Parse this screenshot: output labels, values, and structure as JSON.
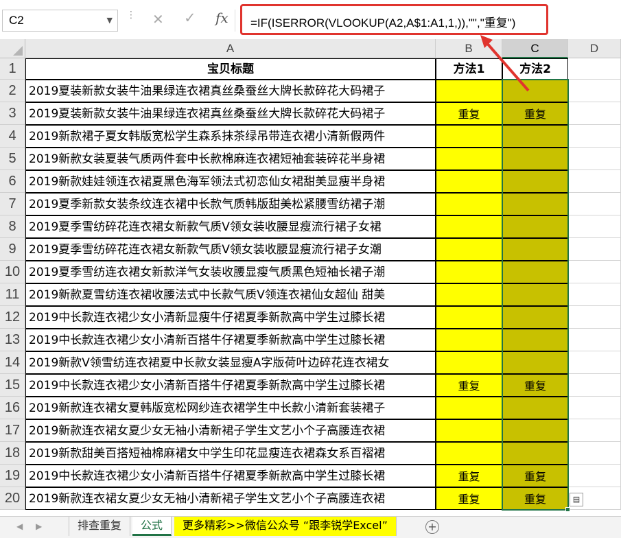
{
  "namebox": {
    "value": "C2"
  },
  "formula_bar": {
    "fx_label": "fx",
    "formula": "=IF(ISERROR(VLOOKUP(A2,A$1:A1,1,)),\"\",\"重复\")"
  },
  "columns": [
    "A",
    "B",
    "C",
    "D"
  ],
  "selected_column": "C",
  "header_row": {
    "a": "宝贝标题",
    "b": "方法1",
    "c": "方法2"
  },
  "rows": [
    {
      "n": "2",
      "a": "2019夏装新款女装牛油果绿连衣裙真丝桑蚕丝大牌长款碎花大码裙子",
      "b": "",
      "c": ""
    },
    {
      "n": "3",
      "a": "2019夏装新款女装牛油果绿连衣裙真丝桑蚕丝大牌长款碎花大码裙子",
      "b": "重复",
      "c": "重复"
    },
    {
      "n": "4",
      "a": "2019新款裙子夏女韩版宽松学生森系抹茶绿吊带连衣裙小清新假两件",
      "b": "",
      "c": ""
    },
    {
      "n": "5",
      "a": "2019新款女装夏装气质两件套中长款棉麻连衣裙短袖套装碎花半身裙",
      "b": "",
      "c": ""
    },
    {
      "n": "6",
      "a": "2019新款娃娃领连衣裙夏黑色海军领法式初恋仙女裙甜美显瘦半身裙",
      "b": "",
      "c": ""
    },
    {
      "n": "7",
      "a": "2019夏季新款女装条纹连衣裙中长款气质韩版甜美松紧腰雪纺裙子潮",
      "b": "",
      "c": ""
    },
    {
      "n": "8",
      "a": "2019夏季雪纺碎花连衣裙女新款气质V领女装收腰显瘦流行裙子女裙",
      "b": "",
      "c": ""
    },
    {
      "n": "9",
      "a": "2019夏季雪纺碎花连衣裙女新款气质V领女装收腰显瘦流行裙子女潮",
      "b": "",
      "c": ""
    },
    {
      "n": "10",
      "a": "2019夏季雪纺连衣裙女新款洋气女装收腰显瘦气质黑色短袖长裙子潮",
      "b": "",
      "c": ""
    },
    {
      "n": "11",
      "a": "2019新款夏雪纺连衣裙收腰法式中长款气质V领连衣裙仙女超仙 甜美",
      "b": "",
      "c": ""
    },
    {
      "n": "12",
      "a": "2019中长款连衣裙少女小清新显瘦牛仔裙夏季新款高中学生过膝长裙",
      "b": "",
      "c": ""
    },
    {
      "n": "13",
      "a": "2019中长款连衣裙少女小清新百搭牛仔裙夏季新款高中学生过膝长裙",
      "b": "",
      "c": ""
    },
    {
      "n": "14",
      "a": "2019新款V领雪纺连衣裙夏中长款女装显瘦A字版荷叶边碎花连衣裙女",
      "b": "",
      "c": ""
    },
    {
      "n": "15",
      "a": "2019中长款连衣裙少女小清新百搭牛仔裙夏季新款高中学生过膝长裙",
      "b": "重复",
      "c": "重复"
    },
    {
      "n": "16",
      "a": "2019新款连衣裙女夏韩版宽松网纱连衣裙学生中长款小清新套装裙子",
      "b": "",
      "c": ""
    },
    {
      "n": "17",
      "a": "2019新款连衣裙女夏少女无袖小清新裙子学生文艺小个子高腰连衣裙",
      "b": "",
      "c": ""
    },
    {
      "n": "18",
      "a": "2019新款甜美百搭短袖棉麻裙女中学生印花显瘦连衣裙森女系百褶裙",
      "b": "",
      "c": ""
    },
    {
      "n": "19",
      "a": "2019中长款连衣裙少女小清新百搭牛仔裙夏季新款高中学生过膝长裙",
      "b": "重复",
      "c": "重复"
    },
    {
      "n": "20",
      "a": "2019新款连衣裙女夏少女无袖小清新裙子学生文艺小个子高腰连衣裙",
      "b": "重复",
      "c": "重复"
    }
  ],
  "header_row_number": "1",
  "tabs": {
    "tab1": "排查重复",
    "tab2": "公式",
    "tab3": "更多精彩>>微信公众号 “跟李锐学Excel”"
  },
  "colors": {
    "yellow": "#ffff00",
    "olive": "#c8c100",
    "accent": "#217346",
    "annotation_red": "#e0342e"
  }
}
